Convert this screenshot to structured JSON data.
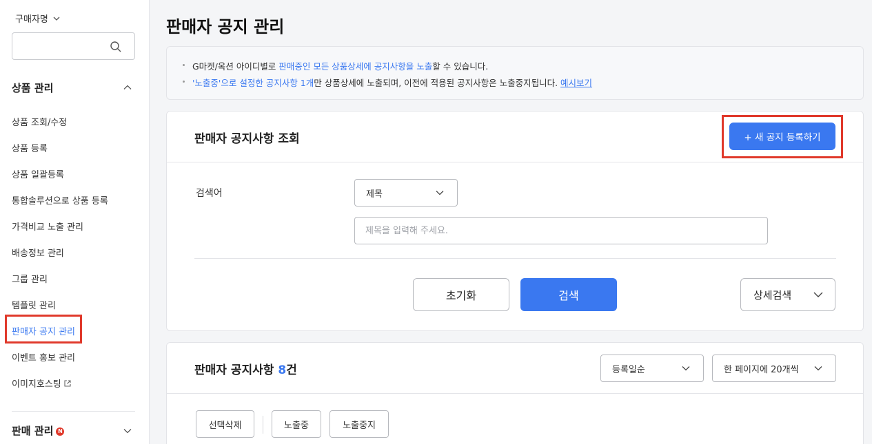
{
  "sidebar": {
    "buyer_name_label": "구매자명",
    "search_value": "",
    "groups": [
      {
        "title": "상품 관리"
      },
      {
        "title": "판매 관리"
      }
    ],
    "items": [
      {
        "label": "상품 조회/수정"
      },
      {
        "label": "상품 등록"
      },
      {
        "label": "상품 일괄등록"
      },
      {
        "label": "통합솔루션으로 상품 등록"
      },
      {
        "label": "가격비교 노출 관리"
      },
      {
        "label": "배송정보 관리"
      },
      {
        "label": "그룹 관리"
      },
      {
        "label": "템플릿 관리"
      },
      {
        "label": "판매자 공지 관리"
      },
      {
        "label": "이벤트 홍보 관리"
      },
      {
        "label": "이미지호스팅"
      }
    ],
    "new_badge": "N"
  },
  "page": {
    "title": "판매자 공지 관리"
  },
  "info": {
    "line1_a": "G마켓/옥션 아이디별로 ",
    "line1_b": "판매중인 모든 상품상세에 공지사항을 노출",
    "line1_c": "할 수 있습니다.",
    "line2_a": "'노출중'으로 설정한 공지사항 1개",
    "line2_b": "만 상품상세에 노출되며, 이전에 적용된 공지사항은 노출중지됩니다. ",
    "line2_link": "예시보기"
  },
  "search_card": {
    "title": "판매자 공지사항 조회",
    "new_button": "+ 새 공지 등록하기",
    "keyword_label": "검색어",
    "select_value": "제목",
    "input_placeholder": "제목을 입력해 주세요.",
    "input_value": "",
    "reset_button": "초기화",
    "search_button": "검색",
    "detail_button": "상세검색"
  },
  "list_card": {
    "title_prefix": "판매자 공지사항 ",
    "count": "8",
    "title_suffix": "건",
    "sort_value": "등록일순",
    "page_size_value": "한 페이지에 20개씩",
    "delete_button": "선택삭제",
    "show_button": "노출중",
    "stop_button": "노출중지"
  },
  "colors": {
    "accent": "#3a78f0",
    "highlight": "#e0392b"
  }
}
